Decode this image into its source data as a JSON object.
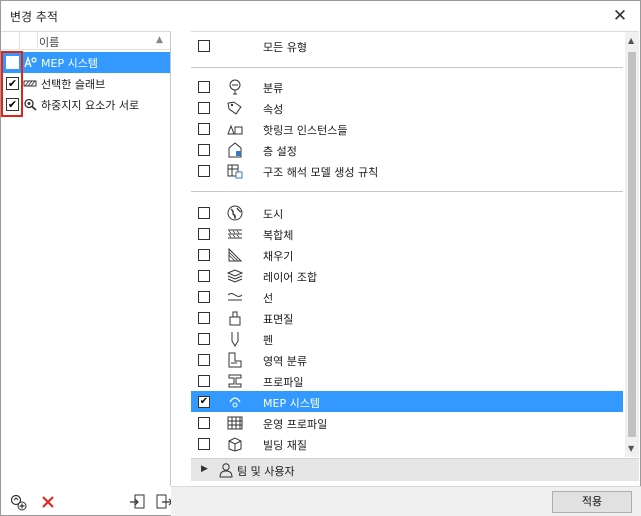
{
  "window": {
    "title": "변경 추적",
    "close_glyph": "✕"
  },
  "left_panel": {
    "column_header": "이름",
    "items": [
      {
        "label": "MEP 시스템",
        "checked": false,
        "selected": true,
        "icon": "mep-system-icon"
      },
      {
        "label": "선택한 슬래브",
        "checked": true,
        "selected": false,
        "icon": "slab-icon"
      },
      {
        "label": "하중지지 요소가 서로",
        "checked": true,
        "selected": false,
        "icon": "inspect-icon"
      }
    ],
    "footer": {
      "icons": [
        "add-marker-icon",
        "delete-icon",
        "import-icon",
        "export-icon"
      ]
    }
  },
  "right_panel": {
    "all_types": {
      "label": "모든 유형",
      "checked": false
    },
    "group1": [
      {
        "label": "분류",
        "icon": "classification-icon",
        "checked": false
      },
      {
        "label": "속성",
        "icon": "property-tag-icon",
        "checked": false
      },
      {
        "label": "핫링크 인스턴스들",
        "icon": "hotlink-icon",
        "checked": false
      },
      {
        "label": "층 설정",
        "icon": "story-icon",
        "checked": false
      },
      {
        "label": "구조 해석 모델 생성 규칙",
        "icon": "structural-rules-icon",
        "checked": false
      }
    ],
    "group2": [
      {
        "label": "도시",
        "icon": "globe-icon",
        "checked": false
      },
      {
        "label": "복합체",
        "icon": "composite-icon",
        "checked": false
      },
      {
        "label": "채우기",
        "icon": "fill-icon",
        "checked": false
      },
      {
        "label": "레이어 조합",
        "icon": "layer-combination-icon",
        "checked": false
      },
      {
        "label": "선",
        "icon": "line-type-icon",
        "checked": false
      },
      {
        "label": "표면질",
        "icon": "surface-icon",
        "checked": false
      },
      {
        "label": "펜",
        "icon": "pen-icon",
        "checked": false
      },
      {
        "label": "영역 분류",
        "icon": "zone-category-icon",
        "checked": false
      },
      {
        "label": "프로파일",
        "icon": "profile-icon",
        "checked": false
      },
      {
        "label": "MEP 시스템",
        "icon": "mep-system-icon",
        "checked": true,
        "selected": true
      },
      {
        "label": "운영 프로파일",
        "icon": "operation-profile-icon",
        "checked": false
      },
      {
        "label": "빌딩 재질",
        "icon": "building-material-icon",
        "checked": false
      }
    ],
    "team_section": {
      "label": "팀 및 사용자",
      "expanded": false
    }
  },
  "apply_button": "적용",
  "colors": {
    "selection": "#3399ff",
    "highlight_frame": "#e2231a",
    "delete": "#e2231a"
  }
}
